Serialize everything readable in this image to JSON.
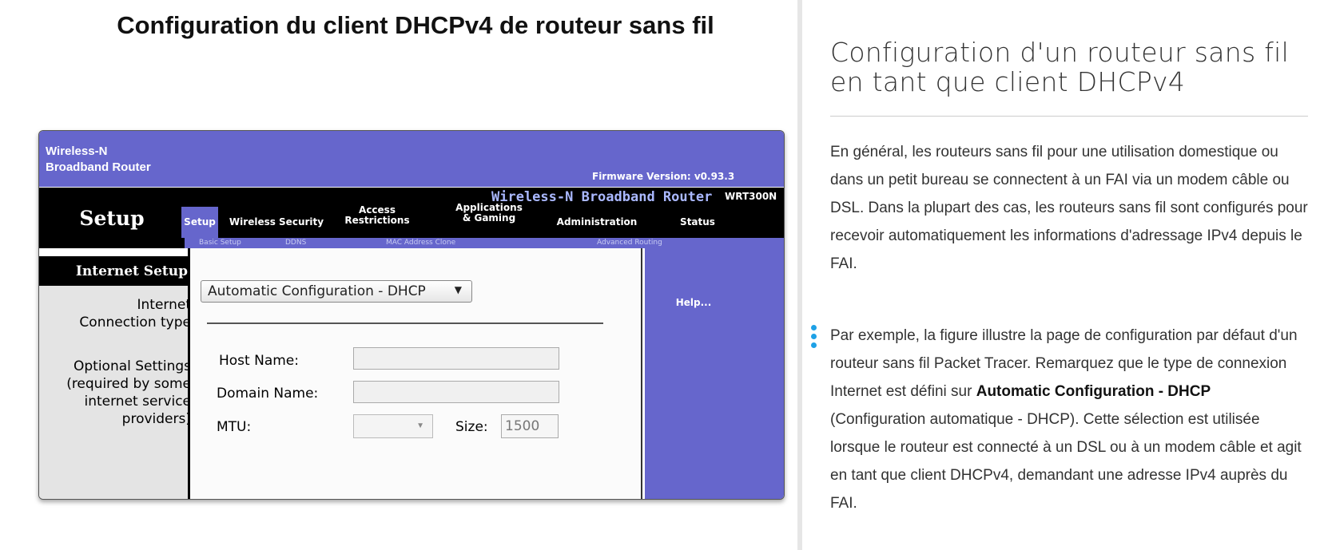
{
  "left": {
    "title": "Configuration du client DHCPv4 de routeur sans fil"
  },
  "router": {
    "brand_line1": "Wireless-N",
    "brand_line2": "Broadband Router",
    "firmware": "Firmware Version: v0.93.3",
    "setup_heading": "Setup",
    "model_title": "Wireless-N Broadband Router",
    "model": "WRT300N",
    "tabs": [
      {
        "line1": "Setup",
        "line2": ""
      },
      {
        "line1": "Wireless Security",
        "line2": ""
      },
      {
        "line1": "Access",
        "line2": "Restrictions"
      },
      {
        "line1": "Applications",
        "line2": "& Gaming"
      },
      {
        "line1": "Administration",
        "line2": ""
      },
      {
        "line1": "Status",
        "line2": ""
      }
    ],
    "subtabs": [
      "Basic Setup",
      "DDNS",
      "MAC Address Clone",
      "Advanced Routing"
    ],
    "section_title": "Internet Setup",
    "labels": {
      "connection_type_1": "Internet",
      "connection_type_2": "Connection type",
      "optional_1": "Optional Settings",
      "optional_2": "(required by some",
      "optional_3": "internet service",
      "optional_4": "providers)"
    },
    "connection_type_value": "Automatic Configuration - DHCP",
    "fields": {
      "host_name_label": "Host Name:",
      "domain_name_label": "Domain Name:",
      "mtu_label": "MTU:",
      "size_label": "Size:",
      "size_value": "1500"
    },
    "help_link": "Help..."
  },
  "right": {
    "title": "Configuration d'un routeur sans fil en tant que client DHCPv4",
    "para1": "En général, les routeurs sans fil pour une utilisation domestique ou dans un petit bureau se connectent à un FAI via un modem câble ou DSL. Dans la plupart des cas, les routeurs sans fil sont configurés pour recevoir automatiquement les informations d'adressage IPv4 depuis le FAI.",
    "para2_a": "Par exemple, la figure illustre la page de configuration par défaut d'un routeur sans fil Packet Tracer. Remarquez que le type de connexion Internet est défini sur ",
    "para2_bold": "Automatic Configuration - DHCP",
    "para2_b": " (Configuration automatique - DHCP). Cette sélection est utilisée lorsque le routeur est connecté à un DSL ou à un modem câble et agit en tant que client DHCPv4, demandant une adresse IPv4 auprès du FAI."
  },
  "colors": {
    "router_purple": "#6666cc",
    "accent_blue": "#1ea1e6"
  }
}
